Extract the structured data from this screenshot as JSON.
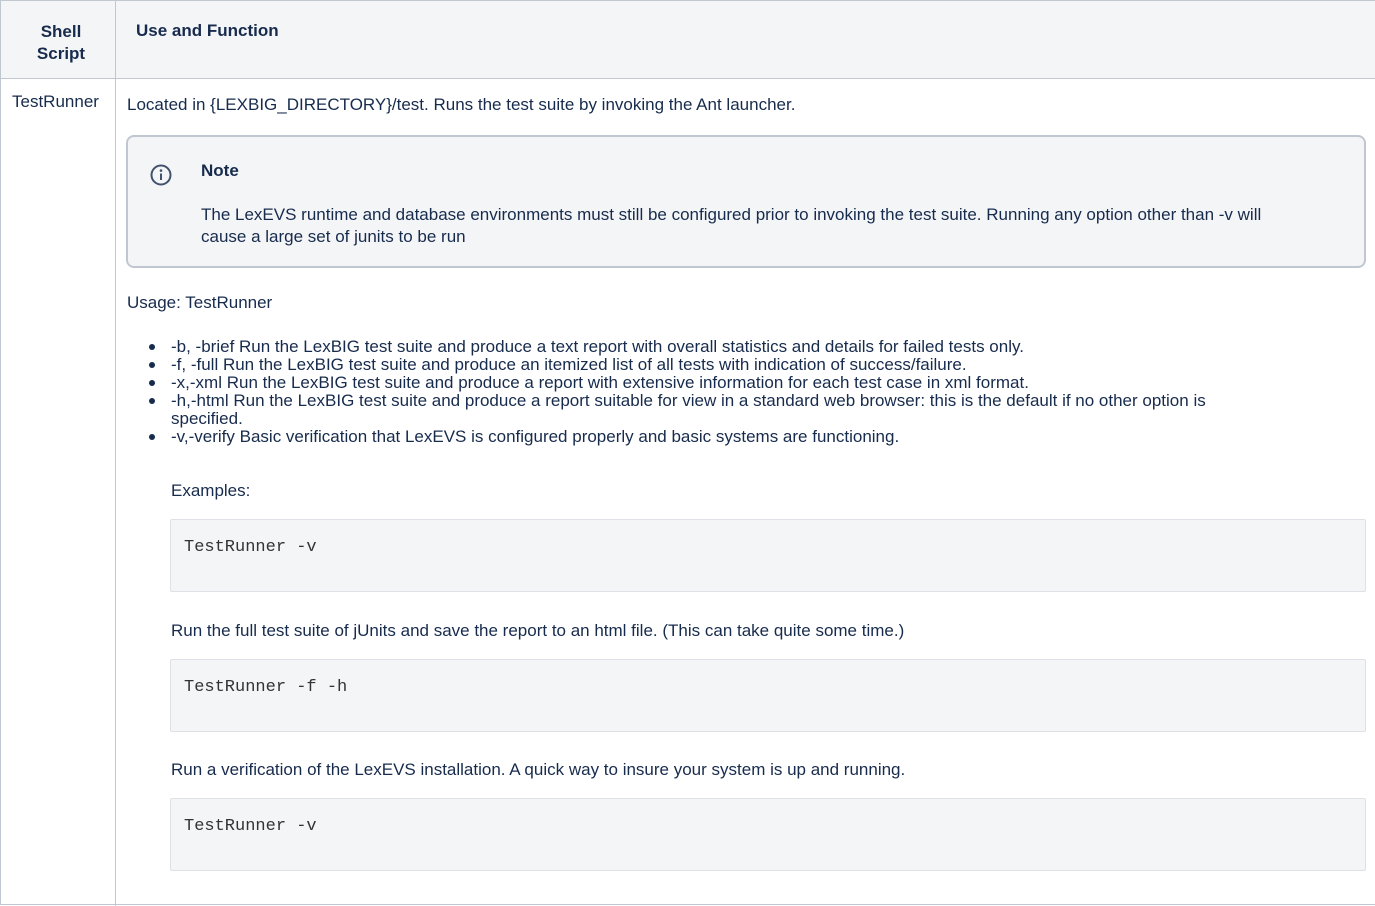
{
  "table": {
    "headers": {
      "shell_script": "Shell Script",
      "use_and_function": "Use and Function"
    },
    "row": {
      "name": "TestRunner",
      "intro": "Located in {LEXBIG_DIRECTORY}/test. Runs the test suite by invoking the Ant launcher.",
      "note": {
        "icon": "info-icon",
        "title": "Note",
        "body": "The LexEVS runtime and database environments must still be configured prior to invoking the test suite. Running any option other than -v will cause a large set of junits to be run"
      },
      "usage": "Usage: TestRunner",
      "options": [
        "-b, -brief Run the LexBIG test suite and produce a text report with overall statistics and details for failed tests only.",
        "-f, -full Run the LexBIG test suite and produce an itemized list of all tests with indication of success/failure.",
        "-x,-xml Run the LexBIG test suite and produce a report with extensive information for each test case in xml format.",
        "-h,-html Run the LexBIG test suite and produce a report suitable for view in a standard web browser: this is the default if no other option is specified.",
        "-v,-verify Basic verification that LexEVS is configured properly and basic systems are functioning."
      ],
      "examples_label": "Examples:",
      "example1_code": "TestRunner -v",
      "example2_desc": "Run the full test suite of jUnits and save the report to an html file. (This can take quite some time.)",
      "example2_code": "TestRunner -f -h",
      "example3_desc": "Run a verification of the LexEVS installation. A quick way to insure your system is up and running.",
      "example3_code": "TestRunner -v"
    }
  },
  "colors": {
    "text": "#172b4d",
    "header_bg": "#f4f5f7",
    "border": "#c1c7d0",
    "note_bg": "#f4f5f7",
    "code_bg": "#f4f5f7",
    "info_icon": "#42526e"
  }
}
